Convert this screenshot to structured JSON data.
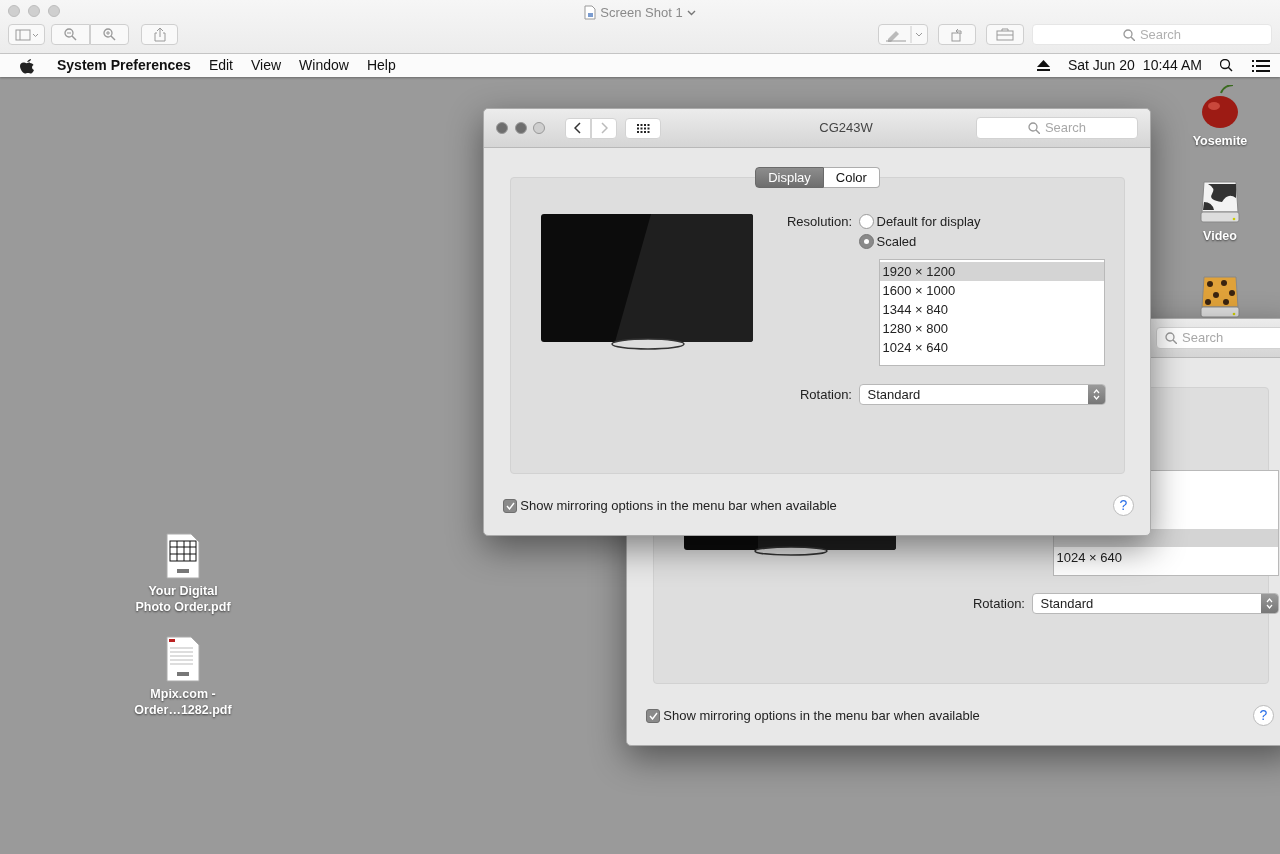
{
  "preview_window": {
    "title": "Screen Shot 1",
    "search": {
      "placeholder": "Search"
    }
  },
  "menu_bar": {
    "app": "System Preferences",
    "items": [
      "Edit",
      "View",
      "Window",
      "Help"
    ],
    "date": "Sat Jun 20",
    "time": "10:44 AM"
  },
  "desktop_icons_right": [
    {
      "label": "Yosemite",
      "kind": "cherry"
    },
    {
      "label": "Video",
      "kind": "cow-drive"
    },
    {
      "kind": "leopard-drive"
    }
  ],
  "desktop_icons_left": [
    {
      "label": "Your Digital Photo Order.pdf",
      "kind": "pdf-grid"
    },
    {
      "label": "Mpix.com - Order…1282.pdf",
      "kind": "pdf-list"
    }
  ],
  "back_window": {
    "search": {
      "placeholder": "Search"
    },
    "resolution_list": [
      {
        "label": "1024 × 640",
        "selected": false
      }
    ],
    "rotation": {
      "label": "Rotation:",
      "value": "Standard"
    },
    "mirroring": {
      "label": "Show mirroring options in the menu bar when available",
      "checked": true
    },
    "help": "?"
  },
  "front_window": {
    "title": "CG243W",
    "search": {
      "placeholder": "Search"
    },
    "tabs": [
      {
        "label": "Display",
        "selected": true
      },
      {
        "label": "Color",
        "selected": false
      }
    ],
    "resolution": {
      "label": "Resolution:",
      "options": [
        {
          "label": "Default for display",
          "selected": false
        },
        {
          "label": "Scaled",
          "selected": true
        }
      ],
      "list": [
        {
          "label": "1920 × 1200",
          "selected": true
        },
        {
          "label": "1600 × 1000",
          "selected": false
        },
        {
          "label": "1344 × 840",
          "selected": false
        },
        {
          "label": "1280 × 800",
          "selected": false
        },
        {
          "label": "1024 × 640",
          "selected": false
        }
      ]
    },
    "rotation": {
      "label": "Rotation:",
      "value": "Standard"
    },
    "mirroring": {
      "label": "Show mirroring options in the menu bar when available",
      "checked": true
    },
    "help": "?"
  }
}
